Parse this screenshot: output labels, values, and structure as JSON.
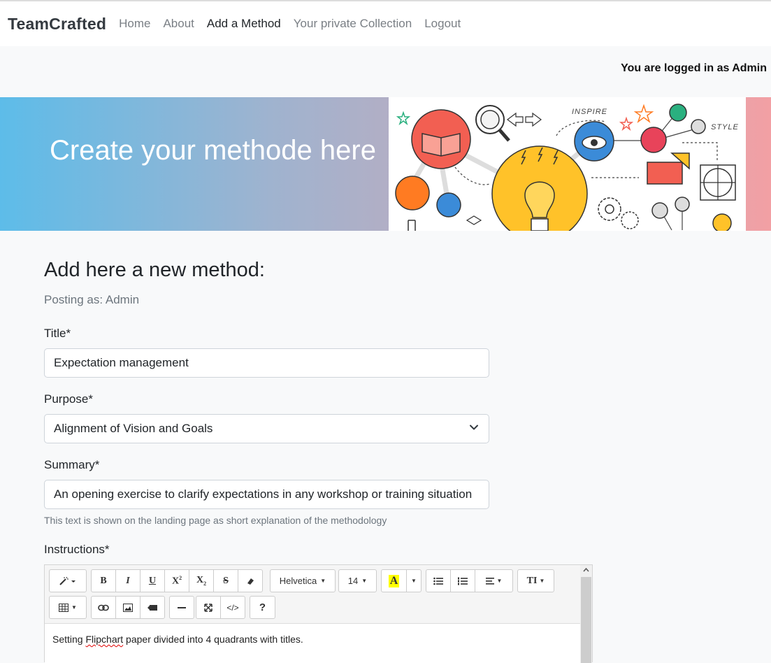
{
  "navbar": {
    "brand": "TeamCrafted",
    "items": [
      "Home",
      "About",
      "Add a Method",
      "Your private Collection",
      "Logout"
    ],
    "active": "Add a Method"
  },
  "login_status": "You are logged in as Admin",
  "banner": {
    "title": "Create your methode here",
    "art_labels": {
      "inspire": "INSPIRE",
      "style": "STYLE"
    }
  },
  "form": {
    "heading": "Add here a new method:",
    "posting_as": "Posting as: Admin",
    "title_label": "Title*",
    "title_value": "Expectation management",
    "purpose_label": "Purpose*",
    "purpose_value": "Alignment of Vision and Goals",
    "summary_label": "Summary*",
    "summary_value": "An opening exercise to clarify expectations in any workshop or training situation",
    "summary_help": "This text is shown on the landing page as short explanation of the methodology",
    "instructions_label": "Instructions*"
  },
  "editor": {
    "font_name": "Helvetica",
    "font_size": "14",
    "help_label": "?",
    "code_label": "</>",
    "content_prefix": "Setting ",
    "content_misspelled": "Flipchart",
    "content_suffix": " paper divided into 4 quadrants with titles."
  }
}
